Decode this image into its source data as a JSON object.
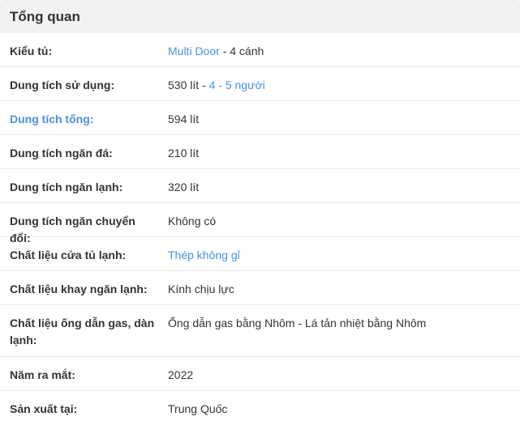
{
  "header": {
    "title": "Tổng quan"
  },
  "specs": {
    "fridge_type": {
      "label": "Kiểu tủ:",
      "value_link": "Multi Door",
      "value_rest": " - 4 cánh"
    },
    "usable_capacity": {
      "label": "Dung tích sử dụng:",
      "value_text": "530 lít - ",
      "value_link": "4 - 5 người"
    },
    "total_capacity": {
      "label": "Dung tích tổng:",
      "value": "594 lít"
    },
    "freezer_capacity": {
      "label": "Dung tích ngăn đá:",
      "value": "210 lít"
    },
    "fridge_capacity": {
      "label": "Dung tích ngăn lạnh:",
      "value": "320 lít"
    },
    "convertible_capacity": {
      "label": "Dung tích ngăn chuyển đổi:",
      "value": "Không có"
    },
    "door_material": {
      "label": "Chất liệu cửa tủ lạnh:",
      "value_link": "Thép không gỉ"
    },
    "tray_material": {
      "label": "Chất liệu khay ngăn lạnh:",
      "value": "Kính chịu lực"
    },
    "gas_pipe_material": {
      "label": "Chất liệu ống dẫn gas, dàn lạnh:",
      "value": "Ống dẫn gas bằng Nhôm - Lá tản nhiệt bằng Nhôm"
    },
    "release_year": {
      "label": "Năm ra mắt:",
      "value": "2022"
    },
    "made_in": {
      "label": "Sản xuất tại:",
      "value": "Trung Quốc"
    }
  },
  "colors": {
    "link": "#4a90e2",
    "header_bg": "#f2f2f2",
    "text": "#333333",
    "divider": "#ebebeb"
  }
}
